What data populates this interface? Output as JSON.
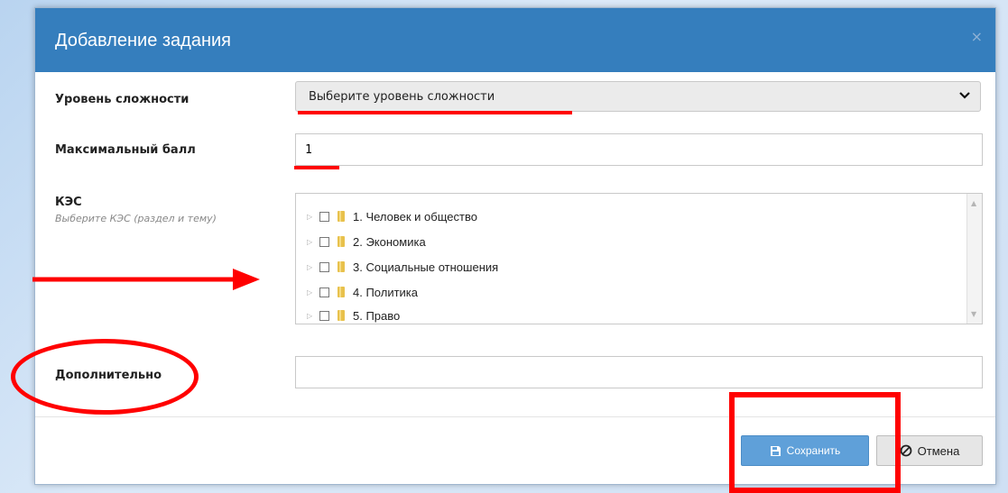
{
  "dialog": {
    "title": "Добавление задания",
    "close_glyph": "×"
  },
  "form": {
    "difficulty": {
      "label": "Уровень сложности",
      "selected_value": "Выберите уровень сложности"
    },
    "max_score": {
      "label": "Максимальный балл",
      "value": "1"
    },
    "kes": {
      "label": "КЭС",
      "hint": "Выберите КЭС (раздел и тему)",
      "items": [
        {
          "label": "1. Человек и общество"
        },
        {
          "label": "2. Экономика"
        },
        {
          "label": "3. Социальные отношения"
        },
        {
          "label": "4. Политика"
        },
        {
          "label": "5. Право"
        }
      ]
    },
    "additional": {
      "label": "Дополнительно",
      "value": ""
    }
  },
  "footer": {
    "save_label": "Сохранить",
    "cancel_label": "Отмена"
  },
  "colors": {
    "header": "#357ebd",
    "save_button": "#5fa0d9",
    "annotation": "#ff0000"
  },
  "icons": {
    "save": "save-icon",
    "cancel": "cancel-icon",
    "folder": "folder-icon",
    "expand": "triangle-right-icon",
    "dropdown": "chevron-down-icon"
  }
}
